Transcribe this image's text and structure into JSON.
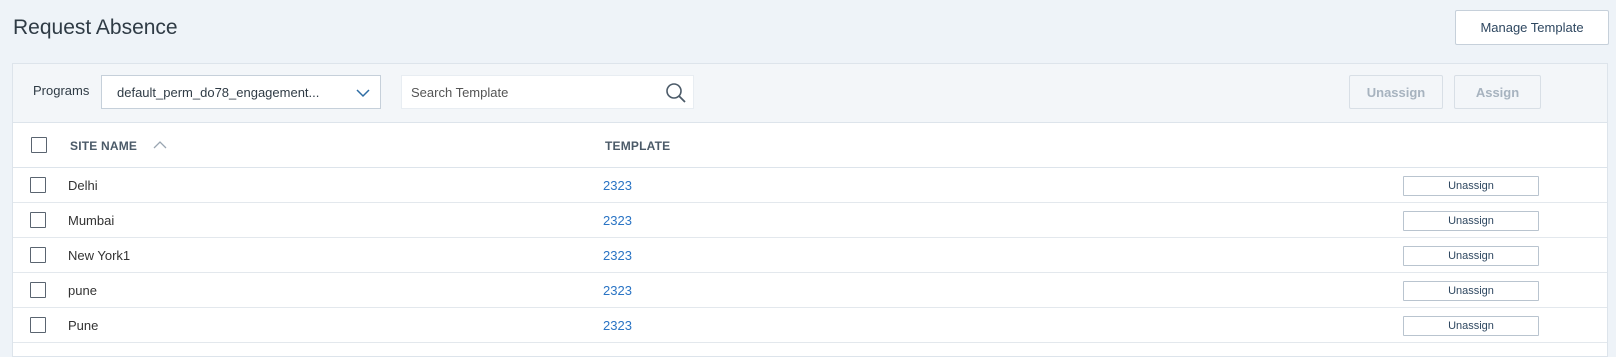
{
  "page": {
    "title": "Request Absence",
    "manage_template_label": "Manage Template"
  },
  "toolbar": {
    "programs_label": "Programs",
    "programs_selected": "default_perm_do78_engagement...",
    "search_placeholder": "Search Template",
    "unassign_label": "Unassign",
    "assign_label": "Assign"
  },
  "table": {
    "columns": {
      "site_name": "SITE NAME",
      "template": "TEMPLATE"
    },
    "sort": {
      "column": "site_name",
      "direction": "ascending"
    },
    "row_action_label": "Unassign",
    "rows": [
      {
        "site": "Delhi",
        "template": "2323"
      },
      {
        "site": "Mumbai",
        "template": "2323"
      },
      {
        "site": "New York1",
        "template": "2323"
      },
      {
        "site": "pune",
        "template": "2323"
      },
      {
        "site": "Pune",
        "template": "2323"
      }
    ]
  },
  "colors": {
    "background": "#eef3f8",
    "link": "#2a74c4",
    "disabled_text": "#a7b3bf"
  },
  "icons": {
    "dropdown": "chevron-down-icon",
    "search": "search-icon",
    "sort": "chevron-up-icon"
  }
}
